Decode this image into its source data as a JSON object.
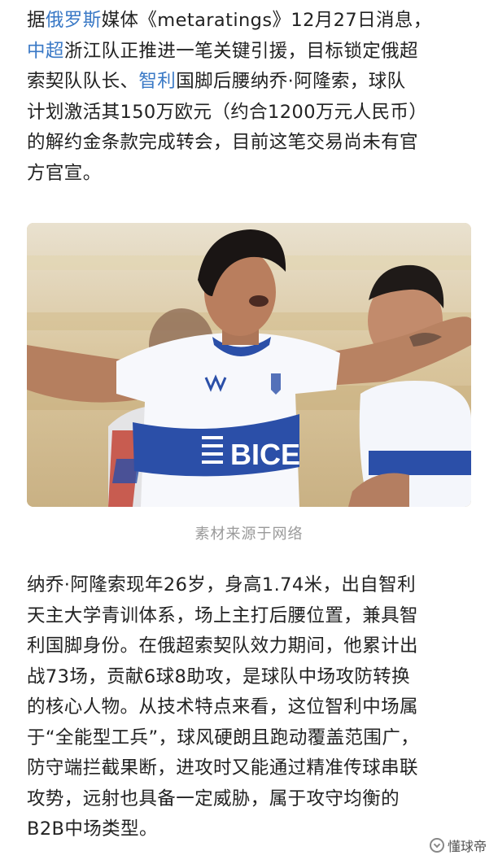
{
  "article": {
    "paragraph1": {
      "line1": {
        "pre": "据",
        "link": "俄罗斯",
        "post": "媒体《metaratings》12月27日消息，"
      },
      "line2": {
        "link": "中超",
        "post": "浙江队正推进一笔关键引援，目标锁定俄超"
      },
      "line3": {
        "pre": "索契队队长、",
        "link": "智利",
        "post": "国脚后腰纳乔·阿隆索，球队"
      },
      "line4": "计划激活其150万欧元（约合1200万元人民币）",
      "line5": "的解约金条款完成转会，目前这笔交易尚未有官",
      "line6": "方官宣。"
    },
    "image": {
      "jersey_sponsor": "BICE",
      "caption": "素材来源于网络"
    },
    "paragraph2": {
      "lines": [
        "纳乔·阿隆索现年26岁，身高1.74米，出自智利",
        "天主大学青训体系，场上主打后腰位置，兼具智",
        "利国脚身份。在俄超索契队效力期间，他累计出",
        "战73场，贡献6球8助攻，是球队中场攻防转换",
        "的核心人物。从技术特点来看，这位智利中场属",
        "于“全能型工兵”，球风硬朗且跑动覆盖范围广，",
        "防守端拦截果断，进攻时又能通过精准传球串联",
        "攻势，远射也具备一定威胁，属于攻守均衡的",
        "B2B中场类型。"
      ]
    },
    "watermark": {
      "icon": "checkmark-circle-icon",
      "text": "懂球帝"
    }
  },
  "colors": {
    "link": "#3a79c6",
    "text": "#222222",
    "caption": "#9a9a9a",
    "jersey_blue": "#2b4fa8"
  }
}
